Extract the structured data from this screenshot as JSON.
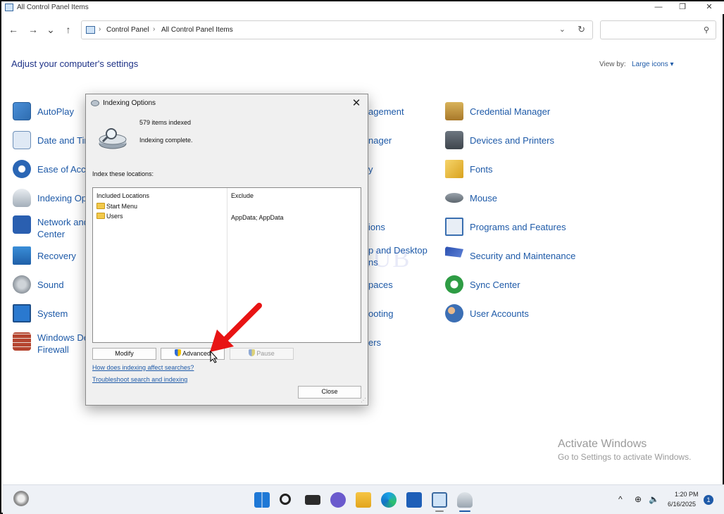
{
  "window": {
    "title": "All Control Panel Items",
    "minimize": "—",
    "maximize": "❐",
    "close": "✕"
  },
  "nav": {
    "back": "←",
    "forward": "→",
    "recent": "⌄",
    "up": "↑"
  },
  "address": {
    "crumbs": [
      "Control Panel",
      "All Control Panel Items"
    ],
    "separator": "›"
  },
  "search": {
    "placeholder": ""
  },
  "page": {
    "heading": "Adjust your computer's settings",
    "view_by_label": "View by:",
    "view_by_value": "Large icons ▾"
  },
  "items": {
    "col1": [
      {
        "label": "AutoPlay",
        "icon": "autoplay-icon"
      },
      {
        "label": "Date and Tir",
        "icon": "date-time-icon"
      },
      {
        "label": "Ease of Acce",
        "icon": "ease-of-access-icon"
      },
      {
        "label": "Indexing Op",
        "icon": "indexing-options-icon"
      },
      {
        "label": "Network and",
        "label2": "Center",
        "icon": "network-icon"
      },
      {
        "label": "Recovery",
        "icon": "recovery-icon"
      },
      {
        "label": "Sound",
        "icon": "sound-icon"
      },
      {
        "label": "System",
        "icon": "system-icon"
      },
      {
        "label": "Windows De",
        "label2": "Firewall",
        "icon": "firewall-icon"
      }
    ],
    "col2": [
      {
        "label": "agement"
      },
      {
        "label": "nager"
      },
      {
        "label": "y"
      },
      {
        "label": "ions"
      },
      {
        "label": "p and Desktop",
        "label2": "ns"
      },
      {
        "label": "paces"
      },
      {
        "label": "ooting"
      },
      {
        "label": "ers"
      }
    ],
    "col3": [
      {
        "label": "Credential Manager",
        "icon": "credential-manager-icon"
      },
      {
        "label": "Devices and Printers",
        "icon": "devices-printers-icon"
      },
      {
        "label": "Fonts",
        "icon": "fonts-icon"
      },
      {
        "label": "Mouse",
        "icon": "mouse-icon"
      },
      {
        "label": "Programs and Features",
        "icon": "programs-features-icon"
      },
      {
        "label": "Security and Maintenance",
        "icon": "security-flag-icon"
      },
      {
        "label": "Sync Center",
        "icon": "sync-center-icon"
      },
      {
        "label": "User Accounts",
        "icon": "user-accounts-icon"
      }
    ]
  },
  "watermark": "IT Pros HUB",
  "dialog": {
    "title": "Indexing Options",
    "close": "✕",
    "items_indexed": "579 items indexed",
    "status": "Indexing complete.",
    "index_label": "Index these locations:",
    "col_included": "Included Locations",
    "col_exclude": "Exclude",
    "locations": [
      "Start Menu",
      "Users"
    ],
    "exclude_value": "AppData; AppData",
    "buttons": {
      "modify": "Modify",
      "advanced": "Advanced",
      "pause": "Pause",
      "close": "Close"
    },
    "link1": "How does indexing affect searches?",
    "link2": "Troubleshoot search and indexing"
  },
  "activation": {
    "title": "Activate Windows",
    "subtitle": "Go to Settings to activate Windows."
  },
  "taskbar": {
    "time": "1:20 PM",
    "date": "6/16/2025",
    "notifications": "1",
    "tray": {
      "chevron": "^",
      "globe": "⊕",
      "speaker": "🔈"
    }
  },
  "colors": {
    "link": "#1e5aa8",
    "heading": "#1e3287",
    "arrow": "#e81414"
  }
}
